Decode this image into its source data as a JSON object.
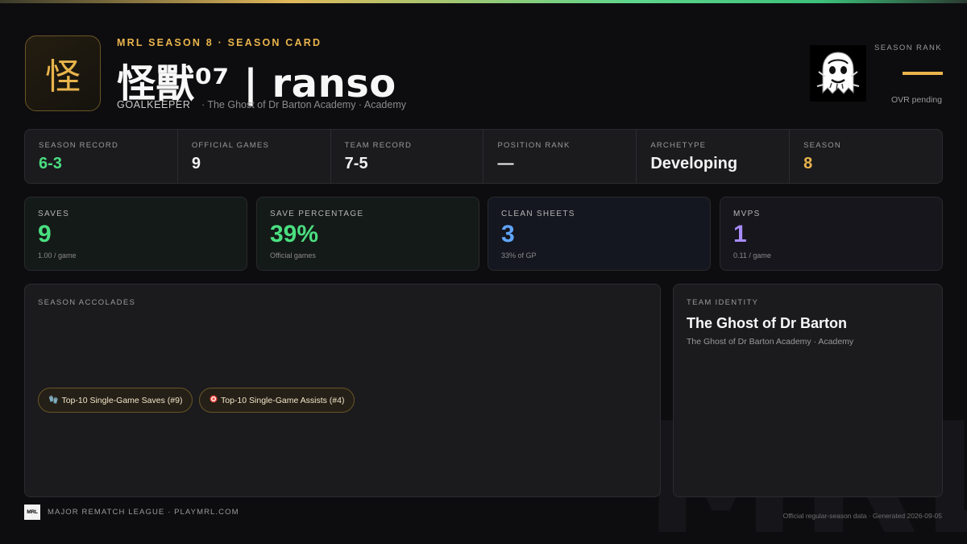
{
  "header": {
    "kicker": "MRL SEASON 8 · SEASON CARD",
    "logo_glyph": "怪",
    "player_name": "怪獸⁰⁷ | ranso",
    "position": "GOALKEEPER",
    "team_line": "· The Ghost of Dr Barton Academy · Academy",
    "season_rank_label": "SEASON RANK",
    "ovr_text": "OVR pending"
  },
  "info_strip": [
    {
      "label": "SEASON RECORD",
      "value": "6-3",
      "color": "#4ade80"
    },
    {
      "label": "OFFICIAL GAMES",
      "value": "9"
    },
    {
      "label": "TEAM RECORD",
      "value": "7-5"
    },
    {
      "label": "POSITION RANK",
      "value": "—"
    },
    {
      "label": "ARCHETYPE",
      "value": "Developing"
    },
    {
      "label": "SEASON",
      "value": "8",
      "color": "#e9b44c"
    }
  ],
  "stats": [
    {
      "label": "SAVES",
      "value": "9",
      "sub": "1.00 / game",
      "color": "#4ade80"
    },
    {
      "label": "SAVE PERCENTAGE",
      "value": "39%",
      "sub": "Official games",
      "color": "#4ade80"
    },
    {
      "label": "CLEAN SHEETS",
      "value": "3",
      "sub": "33% of GP",
      "color": "#60a5fa"
    },
    {
      "label": "MVPS",
      "value": "1",
      "sub": "0.11 / game",
      "color": "#a78bfa"
    }
  ],
  "accolades": {
    "label": "SEASON ACCOLADES",
    "items": [
      {
        "icon": "glove-icon",
        "text": "Top-10 Single-Game Saves (#9)"
      },
      {
        "icon": "target-icon",
        "text": "Top-10 Single-Game Assists (#4)"
      }
    ]
  },
  "team_identity": {
    "label": "TEAM IDENTITY",
    "name": "The Ghost of Dr Barton",
    "desc": "The Ghost of Dr Barton Academy · Academy"
  },
  "footer": {
    "logo_text": "MRL",
    "left": "MAJOR REMATCH LEAGUE · PLAYMRL.COM",
    "right": "Official regular-season data · Generated 2026-09-05",
    "watermark": "MRL"
  }
}
